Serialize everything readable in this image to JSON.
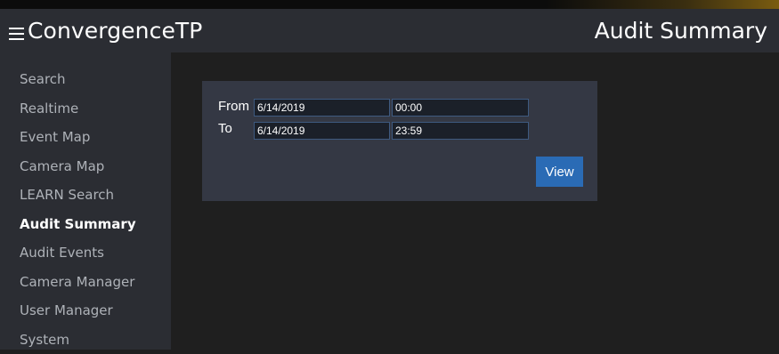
{
  "header": {
    "menu_icon": "hamburger-menu-icon",
    "brand": "ConvergenceTP",
    "page_title": "Audit Summary"
  },
  "sidebar": {
    "items": [
      {
        "label": "Search",
        "active": false
      },
      {
        "label": "Realtime",
        "active": false
      },
      {
        "label": "Event Map",
        "active": false
      },
      {
        "label": "Camera Map",
        "active": false
      },
      {
        "label": "LEARN Search",
        "active": false
      },
      {
        "label": "Audit Summary",
        "active": true
      },
      {
        "label": "Audit Events",
        "active": false
      },
      {
        "label": "Camera Manager",
        "active": false
      },
      {
        "label": "User Manager",
        "active": false
      },
      {
        "label": "System",
        "active": false
      }
    ]
  },
  "form": {
    "from_label": "From",
    "from_date": "6/14/2019",
    "from_time": "00:00",
    "to_label": "To",
    "to_date": "6/14/2019",
    "to_time": "23:59",
    "view_label": "View"
  },
  "colors": {
    "header_bg": "#2b2d33",
    "sidebar_bg": "#2b2d33",
    "main_bg": "#1f1f1f",
    "panel_bg": "#343844",
    "button_bg": "#2a6bb5",
    "input_border": "#3e5a80"
  }
}
